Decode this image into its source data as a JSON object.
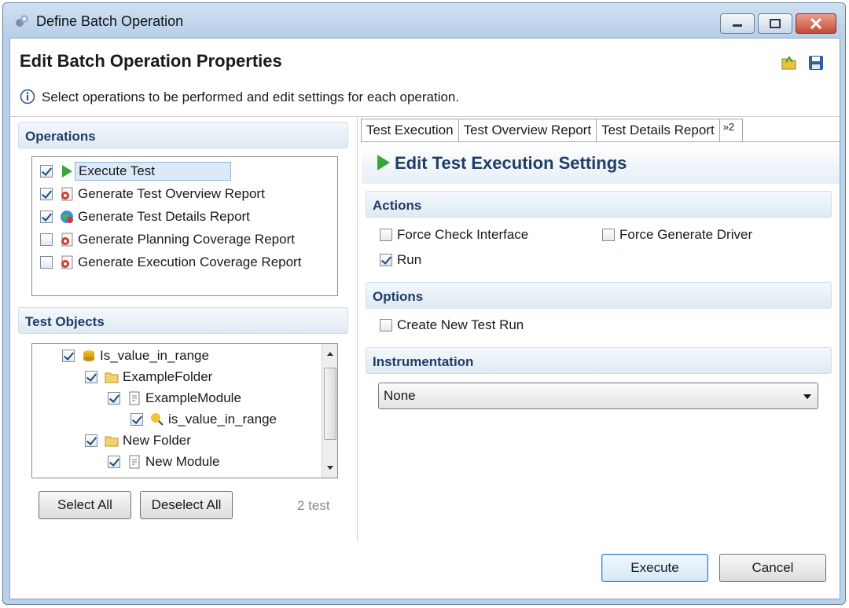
{
  "window": {
    "title": "Define Batch Operation"
  },
  "header": {
    "title": "Edit Batch Operation Properties",
    "info": "Select operations to be performed and edit settings for each operation."
  },
  "operations": {
    "title": "Operations",
    "items": [
      {
        "label": "Execute Test",
        "checked": true,
        "icon": "play-icon"
      },
      {
        "label": "Generate Test Overview Report",
        "checked": true,
        "icon": "report-icon"
      },
      {
        "label": "Generate Test Details Report",
        "checked": true,
        "icon": "globe-report-icon"
      },
      {
        "label": "Generate Planning Coverage Report",
        "checked": false,
        "icon": "report-icon"
      },
      {
        "label": "Generate Execution Coverage Report",
        "checked": false,
        "icon": "report-icon"
      }
    ]
  },
  "test_objects": {
    "title": "Test Objects",
    "items": [
      {
        "label": "Is_value_in_range",
        "icon": "project-icon"
      },
      {
        "label": "ExampleFolder",
        "icon": "folder-icon"
      },
      {
        "label": "ExampleModule",
        "icon": "module-icon"
      },
      {
        "label": "is_value_in_range",
        "icon": "test-object-icon"
      },
      {
        "label": "New Folder",
        "icon": "folder-icon"
      },
      {
        "label": "New Module",
        "icon": "module-icon"
      }
    ],
    "select_all": "Select All",
    "deselect_all": "Deselect All",
    "count": "2 test"
  },
  "tabs": [
    "Test Execution",
    "Test Overview Report",
    "Test Details Report"
  ],
  "tabs_more": "»2",
  "edit": {
    "title": "Edit Test Execution Settings",
    "actions_title": "Actions",
    "force_check_interface": "Force Check Interface",
    "force_generate_driver": "Force Generate Driver",
    "run": "Run",
    "options_title": "Options",
    "create_new_test_run": "Create New Test Run",
    "instrumentation_title": "Instrumentation",
    "instrumentation_value": "None"
  },
  "footer": {
    "execute": "Execute",
    "cancel": "Cancel"
  }
}
